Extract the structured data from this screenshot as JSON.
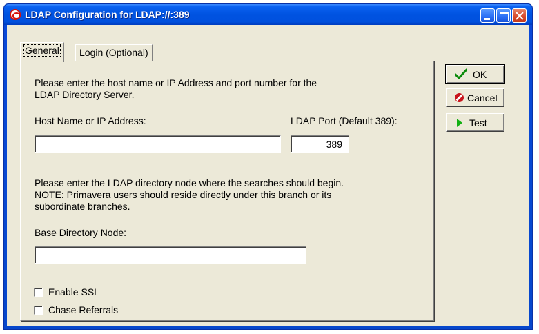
{
  "window": {
    "title": "LDAP Configuration for LDAP://:389",
    "icon": "oracle-icon"
  },
  "tabs": [
    {
      "label": "General",
      "active": true
    },
    {
      "label": "Login (Optional)",
      "active": false
    }
  ],
  "general": {
    "intro_line1": "Please enter the host name or IP Address and port number for the",
    "intro_line2": "LDAP Directory Server.",
    "host_label": "Host Name or IP Address:",
    "host_value": "",
    "port_label": "LDAP Port (Default 389):",
    "port_value": "389",
    "node_line1": "Please enter the LDAP directory node where the searches should begin.",
    "node_line2": "NOTE: Primavera users should reside directly under this branch or its",
    "node_line3": "subordinate branches.",
    "base_label": "Base Directory Node:",
    "base_value": "",
    "ssl_label": "Enable SSL",
    "ssl_checked": false,
    "chase_label": "Chase Referrals",
    "chase_checked": false
  },
  "buttons": {
    "ok": "OK",
    "cancel": "Cancel",
    "test": "Test"
  }
}
